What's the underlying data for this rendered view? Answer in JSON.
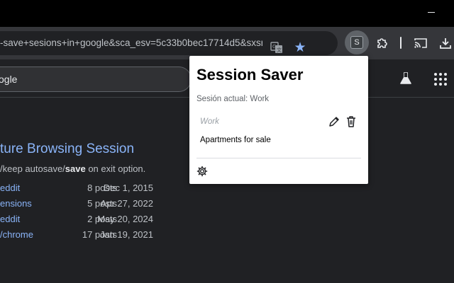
{
  "toolbar": {
    "url": "-save+sesions+in+google&sca_esv=5c33b0bec17714d5&sxsrf...",
    "extension_letter": "S",
    "icons": [
      "translate-icon",
      "star-icon",
      "session-saver-extension-icon",
      "puzzle-icon",
      "cast-icon",
      "download-icon"
    ]
  },
  "page": {
    "search_text": "ogle",
    "result": {
      "title": "ture Browsing Session",
      "snippet_before": "/keep autosave/",
      "snippet_bold": "save",
      "snippet_after": " on exit option."
    },
    "sitelinks": [
      {
        "name": "eddit",
        "posts": "8 posts",
        "date": "Dec 1, 2015"
      },
      {
        "name": "ensions",
        "posts": "5 posts",
        "date": "Apr 27, 2022"
      },
      {
        "name": "eddit",
        "posts": "2 posts",
        "date": "May 20, 2024"
      },
      {
        "name": "/chrome",
        "posts": "17 posts",
        "date": "Jan 19, 2021"
      }
    ]
  },
  "popup": {
    "title": "Session Saver",
    "current_session": "Sesión actual: Work",
    "session_name": "Work",
    "tab_entry": "Apartments for sale"
  }
}
